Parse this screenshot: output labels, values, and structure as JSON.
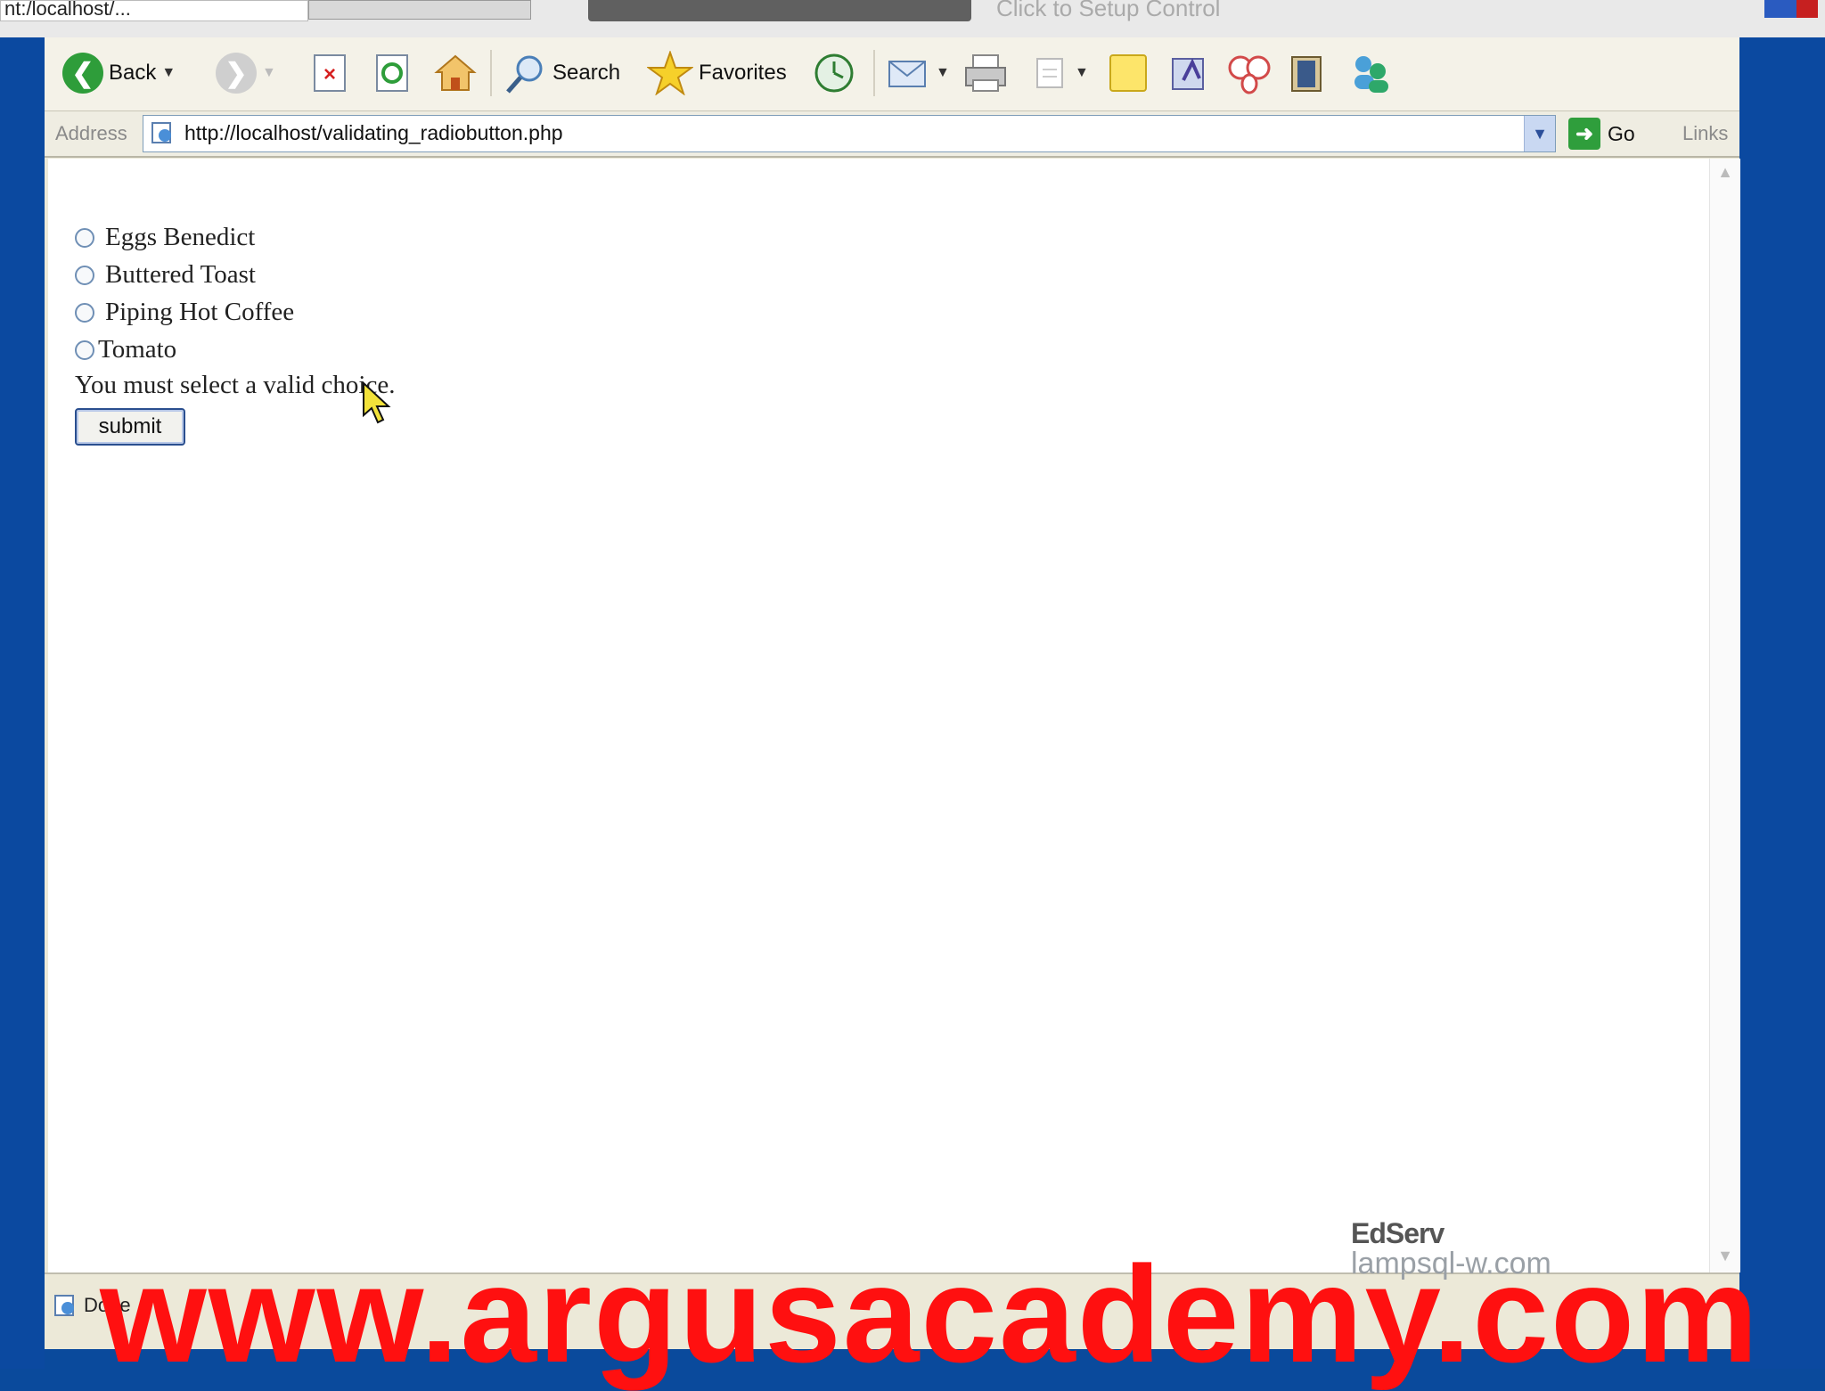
{
  "top_strip": {
    "url_fragment": "nt:/localhost/...",
    "hint": "Click to Setup Control"
  },
  "toolbar": {
    "back_label": "Back",
    "search_label": "Search",
    "favorites_label": "Favorites"
  },
  "address": {
    "label": "Address",
    "url": "http://localhost/validating_radiobutton.php",
    "go_label": "Go",
    "links_label": "Links"
  },
  "form": {
    "options": [
      "Eggs Benedict",
      "Buttered Toast",
      "Piping Hot Coffee",
      "Tomato"
    ],
    "error_message": "You must select a valid choice.",
    "submit_label": "submit"
  },
  "status": {
    "text": "Done"
  },
  "logo": {
    "brand": "EdServ",
    "site": "lampsql-w.com"
  },
  "watermark": "www.argusacademy.com",
  "colors": {
    "watermark": "#ff1010",
    "frame": "#0b49a0",
    "content_bg": "#ffffff"
  }
}
